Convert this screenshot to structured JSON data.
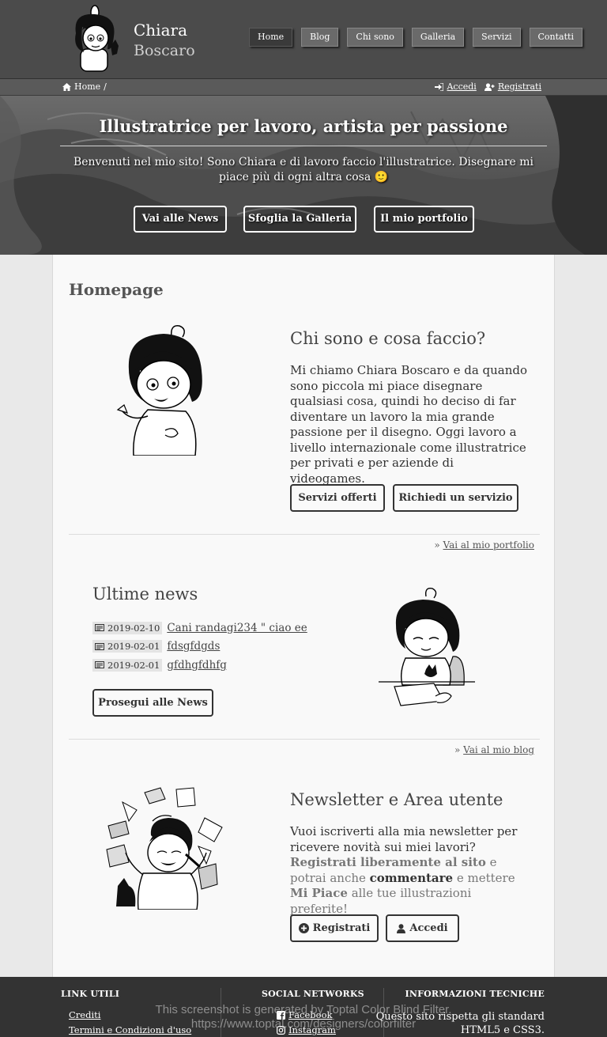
{
  "header": {
    "brand_first": "Chiara",
    "brand_last": "Boscaro",
    "nav": [
      "Home",
      "Blog",
      "Chi sono",
      "Galleria",
      "Servizi",
      "Contatti"
    ],
    "active_nav": "Home"
  },
  "breadcrumb": {
    "home_label": "Home",
    "separator": "/",
    "login_label": "Accedi",
    "register_label": "Registrati"
  },
  "hero": {
    "title": "Illustratrice per lavoro, artista per passione",
    "text": "Benvenuti nel mio sito! Sono Chiara e di lavoro faccio l'illustratrice. Disegnare mi piace più di ogni altra cosa 🙂",
    "buttons": [
      "Vai alle News",
      "Sfoglia la Galleria",
      "Il mio portfolio"
    ]
  },
  "main": {
    "page_title": "Homepage",
    "about": {
      "title": "Chi sono e cosa faccio?",
      "text": "Mi chiamo Chiara Boscaro e da quando sono piccola mi piace disegnare qualsiasi cosa, quindi ho deciso di far diventare un lavoro la mia grande passione per il disegno. Oggi lavoro a livello internazionale come illustratrice per privati e per aziende di videogames.",
      "btn_services": "Servizi offerti",
      "btn_request": "Richiedi un servizio",
      "more_prefix": "»",
      "more_link": "Vai al mio portfolio"
    },
    "news": {
      "title": "Ultime news",
      "items": [
        {
          "date": "2019-02-10",
          "title": "Cani randagi234 \" ciao ee"
        },
        {
          "date": "2019-02-01",
          "title": "fdsgfdgds"
        },
        {
          "date": "2019-02-01",
          "title": "gfdhgfdhfg"
        }
      ],
      "btn_more": "Prosegui alle News",
      "more_prefix": "»",
      "more_link": "Vai al mio blog"
    },
    "newsletter": {
      "title": "Newsletter e Area utente",
      "text_1": "Vuoi iscriverti alla mia newsletter per ricevere novità sui miei lavori?",
      "bold_1": "Registrati liberamente al sito",
      "text_2": " e potrai anche ",
      "bold_2": "commentare",
      "text_3": " e mettere ",
      "bold_3": "Mi Piace",
      "text_4": " alle tue illustrazioni preferite!",
      "btn_register": "Registrati",
      "btn_login": "Accedi"
    }
  },
  "footer": {
    "col1_title": "LINK UTILI",
    "col1_links": [
      "Crediti",
      "Termini e Condizioni d'uso"
    ],
    "col2_title": "SOCIAL NETWORKS",
    "col2_links": [
      "Facebook",
      "Instagram"
    ],
    "col3_title": "INFORMAZIONI TECNICHE",
    "col3_line1": "Questo sito rispetta gli standard",
    "col3_line2": "HTML5 e CSS3."
  },
  "watermark": {
    "line1": "This screenshot is generated by Toptal Color Blind Filter.",
    "line2": "https://www.toptal.com/designers/colorfilter"
  },
  "icons": [
    "home-icon",
    "sign-in-icon",
    "user-plus-icon",
    "newspaper-icon",
    "plus-circle-icon",
    "user-icon",
    "facebook-icon",
    "instagram-icon"
  ],
  "colors": {
    "header_bg": "#4b4b4b",
    "footer_bg": "#333333",
    "panel_bg": "#f9f9f9",
    "button_border": "#333333"
  }
}
